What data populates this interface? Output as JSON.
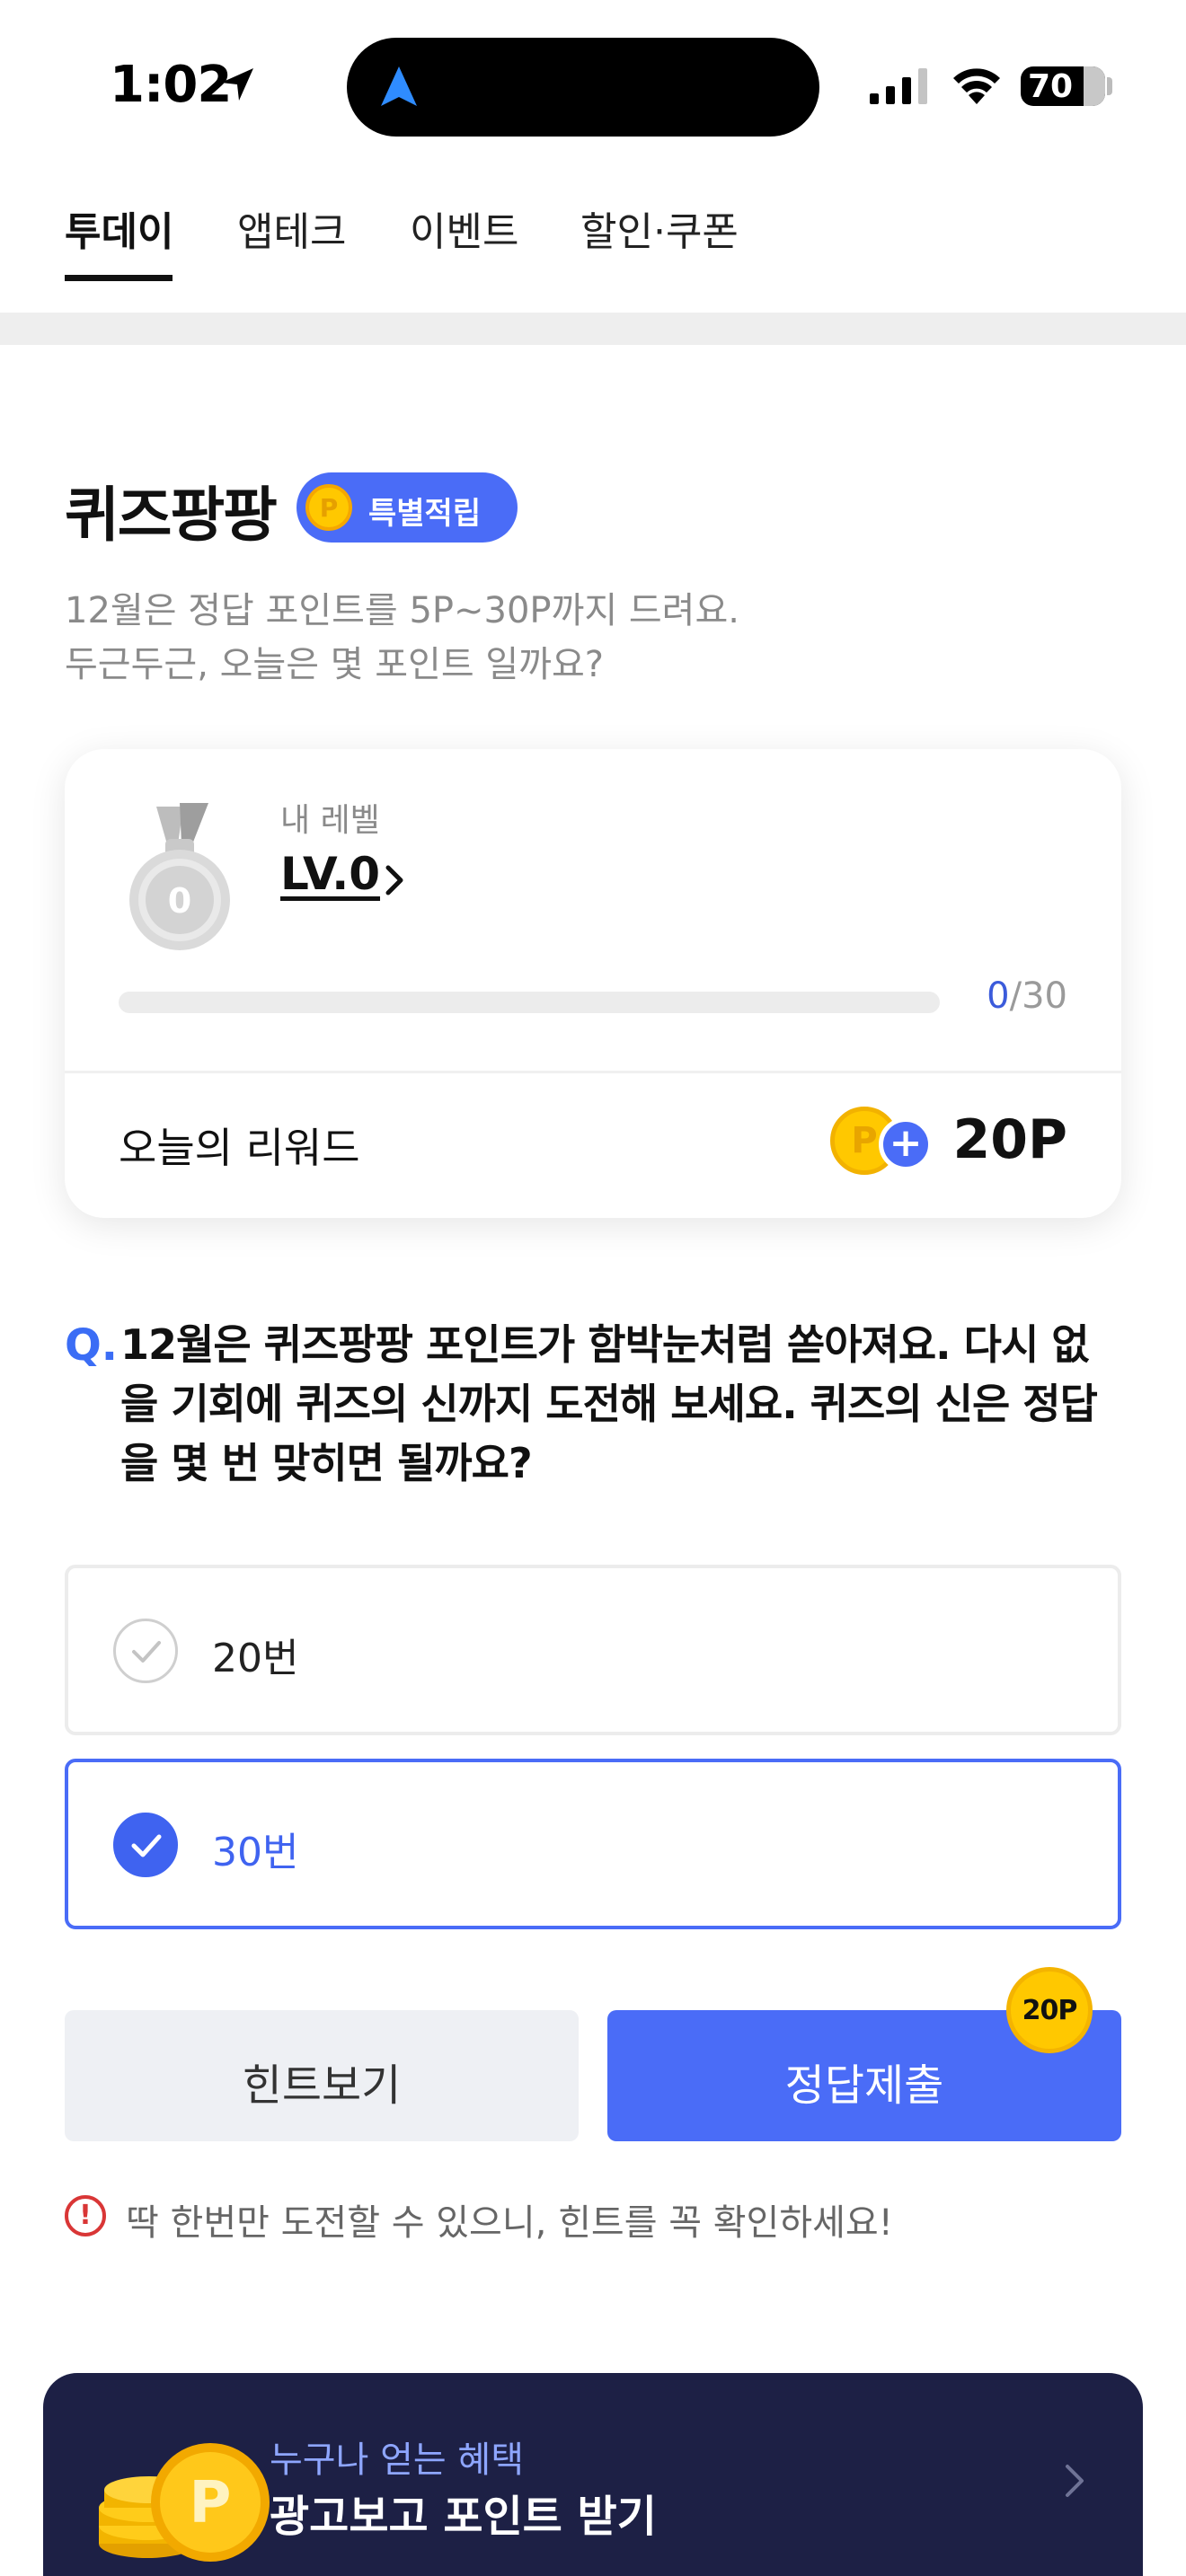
{
  "status_bar": {
    "time": "1:02",
    "battery": "70"
  },
  "tabs": [
    {
      "label": "투데이",
      "active": true
    },
    {
      "label": "앱테크",
      "active": false
    },
    {
      "label": "이벤트",
      "active": false
    },
    {
      "label": "할인·쿠폰",
      "active": false
    }
  ],
  "quiz": {
    "title": "퀴즈팡팡",
    "badge_coin": "P",
    "badge_label": "특별적립",
    "subtitle_line1": "12월은 정답 포인트를 5P~30P까지 드려요.",
    "subtitle_line2": "두근두근, 오늘은 몇 포인트 일까요?"
  },
  "level_card": {
    "caption": "내 레벨",
    "level": "LV.0",
    "medal_number": "0",
    "progress_current": "0",
    "progress_total": "/30",
    "progress_fraction": 0,
    "reward_label": "오늘의 리워드",
    "reward_coin": "P",
    "reward_value": "20P"
  },
  "question": {
    "mark": "Q.",
    "text": "12월은 퀴즈팡팡 포인트가 함박눈처럼 쏟아져요. 다시 없을 기회에 퀴즈의 신까지 도전해 보세요. 퀴즈의 신은 정답을 몇 번 맞히면 될까요?"
  },
  "options": [
    {
      "label": "20번",
      "selected": false
    },
    {
      "label": "30번",
      "selected": true
    }
  ],
  "buttons": {
    "hint": "힌트보기",
    "submit": "정답제출",
    "submit_badge": "20P"
  },
  "warning": {
    "icon_mark": "!",
    "text": "딱 한번만 도전할 수 있으니, 힌트를 꼭 확인하세요!"
  },
  "ad_banner": {
    "caption": "누구나 얻는 혜택",
    "title": "광고보고 포인트 받기"
  },
  "colors": {
    "accent": "#4a6cf7",
    "coin": "#ffc800",
    "banner_bg": "#1d2045",
    "warning": "#d93636"
  }
}
